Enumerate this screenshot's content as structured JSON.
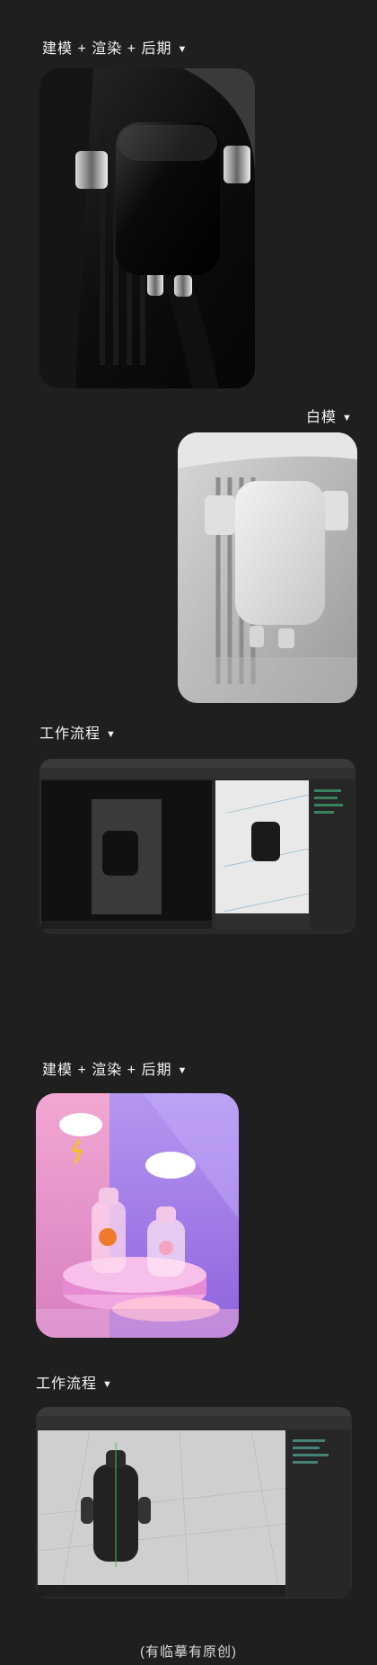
{
  "sections": {
    "s1": {
      "title": "建模 + 渲染 + 后期",
      "arrow": "▼"
    },
    "s2": {
      "title": "白模",
      "arrow": "▼"
    },
    "s3": {
      "title": "工作流程",
      "arrow": "▼"
    },
    "s4": {
      "title": "建模 + 渲染 + 后期",
      "arrow": "▼"
    },
    "s5": {
      "title": "工作流程",
      "arrow": "▼"
    }
  },
  "footer": {
    "text": "(有临摹有原创)"
  },
  "icons": {
    "section_marker": "triangle-down-icon"
  }
}
